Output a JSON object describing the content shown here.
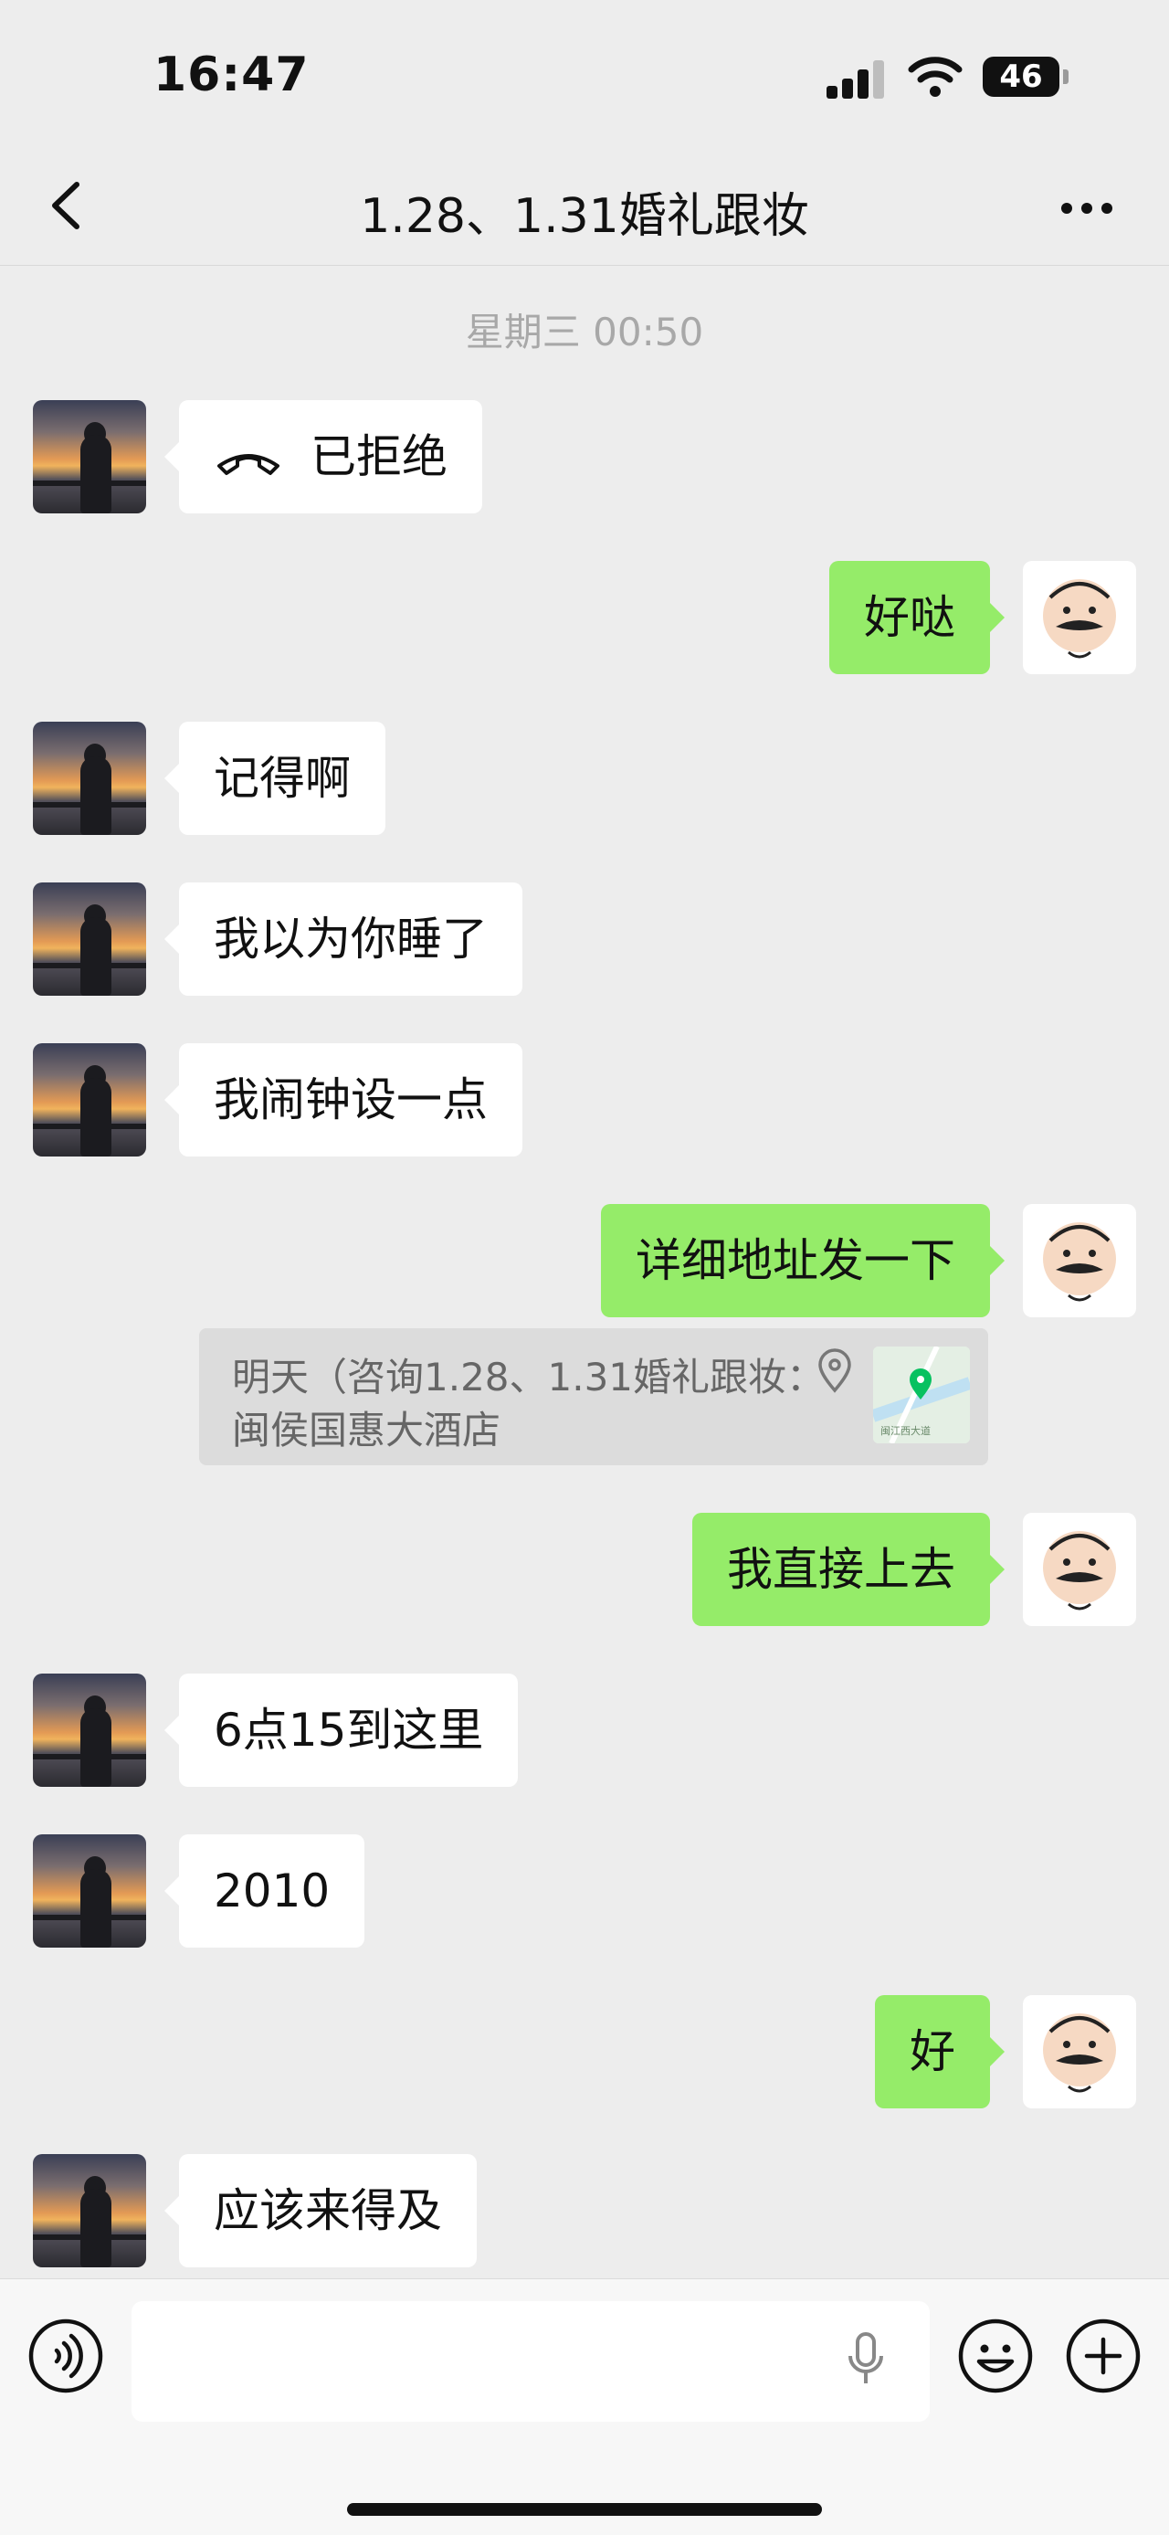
{
  "status_bar": {
    "time": "16:47",
    "battery": "46"
  },
  "header": {
    "title": "1.28、1.31婚礼跟妆"
  },
  "timestamp": "星期三 00:50",
  "messages": [
    {
      "side": "left",
      "text": "已拒绝",
      "icon": "phone-declined-icon"
    },
    {
      "side": "right",
      "text": "好哒"
    },
    {
      "side": "left",
      "text": "记得啊"
    },
    {
      "side": "left",
      "text": "我以为你睡了"
    },
    {
      "side": "left",
      "text": "我闹钟设一点"
    },
    {
      "side": "right",
      "text": "详细地址发一下"
    },
    {
      "side": "right",
      "text": "我直接上去"
    },
    {
      "side": "left",
      "text": "6点15到这里"
    },
    {
      "side": "left",
      "text": "2010"
    },
    {
      "side": "right",
      "text": "好"
    },
    {
      "side": "left",
      "text": "应该来得及"
    }
  ],
  "quote": {
    "line1": "明天（咨询1.28、1.31婚礼跟妆：",
    "line2": "闽侯国惠大酒店",
    "map_label": "闽江西大道",
    "pin_color": "#07c160"
  },
  "input": {
    "placeholder": ""
  },
  "colors": {
    "self_bubble": "#95ec69",
    "other_bubble": "#ffffff",
    "background": "#ededed"
  }
}
